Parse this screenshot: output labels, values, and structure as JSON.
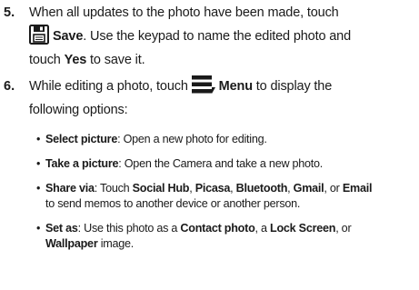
{
  "step5": {
    "number": "5.",
    "line1": "When all updates to the photo have been made, touch",
    "save_label": "Save",
    "line2_rest": ". Use the keypad to name the edited photo and",
    "line3_pre": "touch ",
    "yes_label": "Yes",
    "line3_post": " to save it.",
    "icon": "save-icon"
  },
  "step6": {
    "number": "6.",
    "line1_pre": "While editing a photo, touch ",
    "menu_label": "Menu",
    "line1_post": " to display the",
    "line2": "following options:",
    "icon": "menu-icon"
  },
  "bullets": [
    {
      "term": "Select picture",
      "text": ": Open a new photo for editing."
    },
    {
      "term": "Take a picture",
      "text": ": Open the Camera and take a new photo."
    },
    {
      "term": "Share via",
      "text_a": ": Touch ",
      "opt1": "Social Hub",
      "sep1": ", ",
      "opt2": "Picasa",
      "sep2": ", ",
      "opt3": "Bluetooth",
      "sep3": ", ",
      "opt4": "Gmail",
      "sep4": ", or ",
      "opt5": "Email",
      "line2": "to send memos to another device or another person."
    },
    {
      "term": "Set as",
      "text_a": ": Use this photo as a ",
      "opt1": "Contact photo",
      "sep1": ", a ",
      "opt2": "Lock Screen",
      "sep2": ", or",
      "opt3": "Wallpaper",
      "tail": " image."
    }
  ]
}
